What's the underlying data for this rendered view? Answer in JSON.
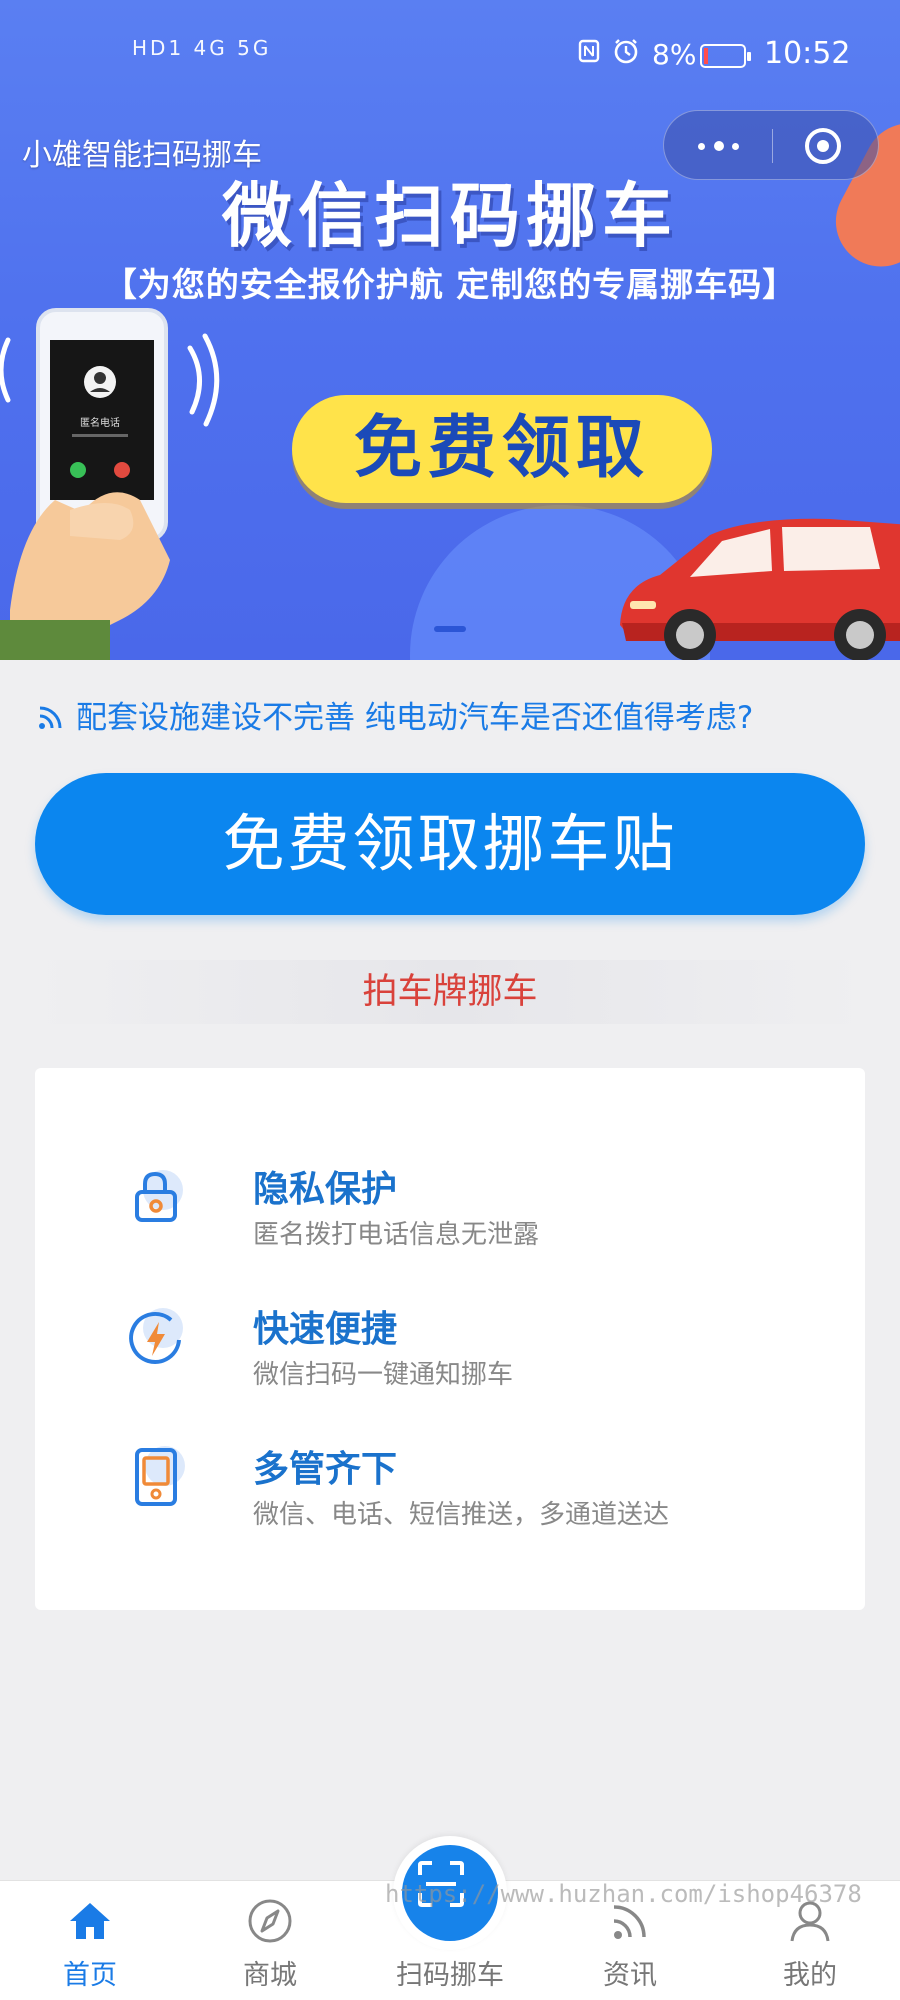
{
  "status_bar": {
    "signals": "HD1 4G 5G",
    "battery_pct": "8%",
    "time": "10:52"
  },
  "app": {
    "title": "小雄智能扫码挪车"
  },
  "banner": {
    "headline": "微信扫码挪车",
    "subline": "【为您的安全报价护航  定制您的专属挪车码】",
    "cta": "免费领取",
    "phone_caption": "匿名电话",
    "slide_index": 1,
    "slide_count": 1
  },
  "notice": {
    "text": "配套设施建设不完善 纯电动汽车是否还值得考虑?"
  },
  "main_button": {
    "label": "免费领取挪车贴"
  },
  "plate_link": {
    "label": "拍车牌挪车"
  },
  "features": [
    {
      "title": "隐私保护",
      "desc": "匿名拨打电话信息无泄露",
      "icon": "lock-icon"
    },
    {
      "title": "快速便捷",
      "desc": "微信扫码一键通知挪车",
      "icon": "lightning-icon"
    },
    {
      "title": "多管齐下",
      "desc": "微信、电话、短信推送，多通道送达",
      "icon": "phone-device-icon"
    }
  ],
  "tabbar": {
    "items": [
      {
        "label": "首页",
        "icon": "home-icon",
        "active": true
      },
      {
        "label": "商城",
        "icon": "compass-icon",
        "active": false
      },
      {
        "label": "扫码挪车",
        "icon": "scan-icon",
        "active": false
      },
      {
        "label": "资讯",
        "icon": "rss-icon",
        "active": false
      },
      {
        "label": "我的",
        "icon": "user-icon",
        "active": false
      }
    ]
  },
  "watermark": "https://www.huzhan.com/ishop46378",
  "colors": {
    "primary": "#0b86ef",
    "feature_title": "#1a72cc",
    "plate_link": "#d9423b",
    "banner_bg": "#5a7ff2",
    "cta_yellow": "#ffe34a"
  }
}
